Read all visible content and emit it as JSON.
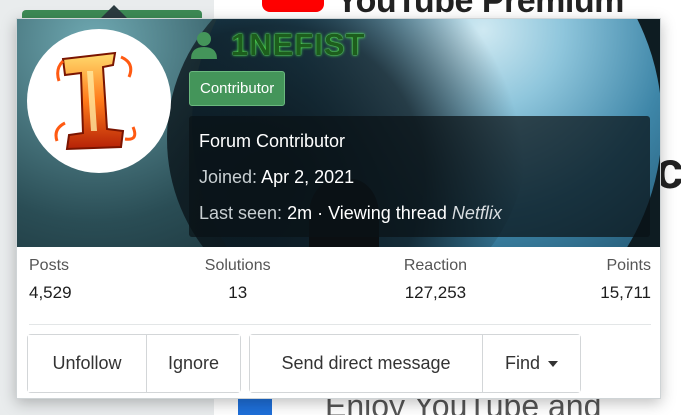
{
  "background": {
    "heading": "YouTube Premium",
    "big_letter": "c",
    "footer_text": "Enjoy YouTube and"
  },
  "profile": {
    "username": "1NEFIST",
    "badge": "Contributor",
    "user_title": "Forum Contributor",
    "joined_label": "Joined:",
    "joined_value": "Apr 2, 2021",
    "last_seen_label": "Last seen:",
    "last_seen_value": "2m · Viewing thread",
    "last_seen_thread": "Netflix",
    "colors": {
      "username": "#1d5e1d",
      "badge": "#44955a",
      "user_icon": "#44955a"
    },
    "icons": {
      "user": "user-icon",
      "avatar": "avatar-flame-one"
    }
  },
  "stats": [
    {
      "label": "Posts",
      "value": "4,529"
    },
    {
      "label": "Solutions",
      "value": "13"
    },
    {
      "label": "Reaction",
      "value": "127,253"
    },
    {
      "label": "Points",
      "value": "15,711"
    }
  ],
  "actions": {
    "unfollow": "Unfollow",
    "ignore": "Ignore",
    "send_message": "Send direct message",
    "find": "Find"
  }
}
